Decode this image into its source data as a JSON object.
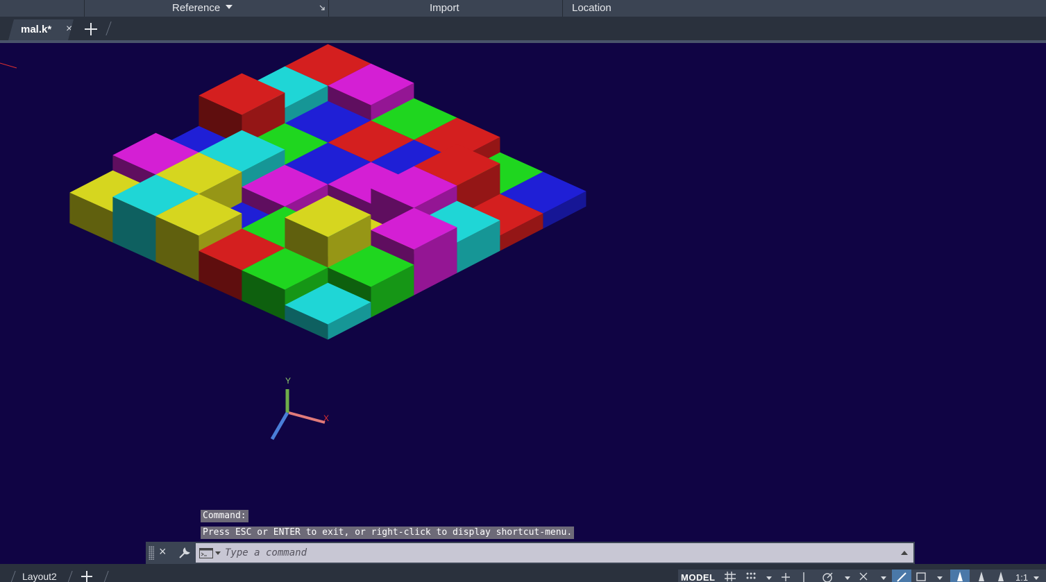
{
  "ribbon": {
    "panels": [
      "Reference",
      "Import",
      "Location"
    ]
  },
  "tabs": {
    "active_document": "mal.k*",
    "close_symbol": "×"
  },
  "commandline": {
    "history": [
      "Command:",
      "Press ESC or ENTER to exit, or right-click to display shortcut-menu."
    ],
    "placeholder": "Type a command",
    "close_symbol": "×"
  },
  "ucs": {
    "x_label": "X",
    "y_label": "Y",
    "colors": {
      "x": "#e07a7a",
      "y": "#6fae4a",
      "z": "#4a7ed8"
    }
  },
  "statusbar": {
    "layout_tab": "Layout2",
    "model_label": "MODEL",
    "scale_label": "1:1",
    "icons": [
      "grid-icon",
      "snap-icon",
      "ortho-icon",
      "polar-icon",
      "isodraft-icon",
      "osnap-icon",
      "lineweight-icon",
      "workspace-icon",
      "annotation-icon",
      "scale-icon"
    ]
  },
  "viewport": {
    "background": "#100444",
    "block_colors": {
      "red": "#d41f1f",
      "blue": "#1f1fd6",
      "yellow": "#d6d61f",
      "cyan": "#1fd6d6",
      "magenta": "#d41fd4",
      "green": "#1fd61f"
    }
  }
}
